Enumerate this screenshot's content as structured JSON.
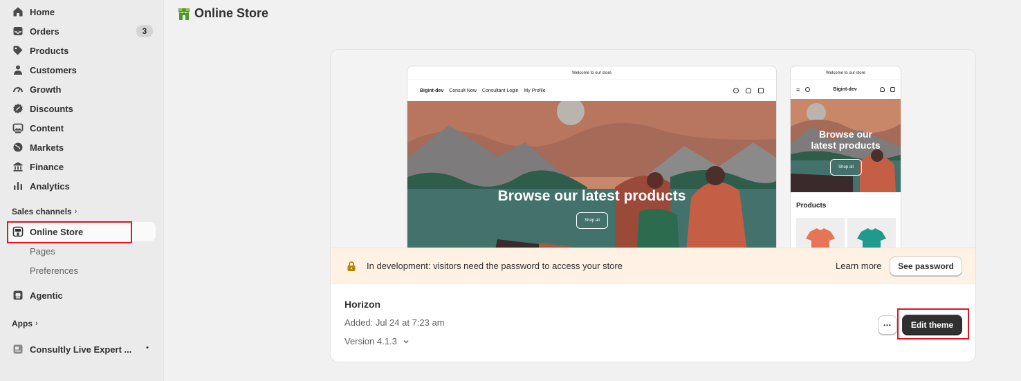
{
  "sidebar": {
    "items": [
      {
        "label": "Home",
        "icon": "home-icon"
      },
      {
        "label": "Orders",
        "icon": "inbox-icon",
        "badge": "3"
      },
      {
        "label": "Products",
        "icon": "tag-icon"
      },
      {
        "label": "Customers",
        "icon": "person-icon"
      },
      {
        "label": "Growth",
        "icon": "gauge-icon"
      },
      {
        "label": "Discounts",
        "icon": "discount-icon"
      },
      {
        "label": "Content",
        "icon": "image-icon"
      },
      {
        "label": "Markets",
        "icon": "globe-icon"
      },
      {
        "label": "Finance",
        "icon": "bank-icon"
      },
      {
        "label": "Analytics",
        "icon": "bar-chart-icon"
      }
    ],
    "sales_channels_label": "Sales channels",
    "online_store_label": "Online Store",
    "sub_items": [
      "Pages",
      "Preferences"
    ],
    "agentic_label": "Agentic",
    "apps_label": "Apps",
    "app_item_label": "Consultly Live Expert ...",
    "app_item_dot": "•"
  },
  "header": {
    "title": "Online Store"
  },
  "preview": {
    "announcement": "Welcome to our store",
    "brand": "Bigint-dev",
    "nav_links": [
      "Consult Now",
      "Consultant Login",
      "My Profile"
    ],
    "hero_title": "Browse our latest products",
    "hero_title_mobile_line1": "Browse our",
    "hero_title_mobile_line2": "latest products",
    "shop_all": "Shop all",
    "products_heading": "Products",
    "menu_glyph": "≡"
  },
  "banner": {
    "message": "In development: visitors need the password to access your store",
    "learn_more": "Learn more",
    "see_password": "See password"
  },
  "theme": {
    "name": "Horizon",
    "added": "Added: Jul 24 at 7:23 am",
    "version": "Version 4.1.3",
    "more_glyph": "•••",
    "edit_button": "Edit theme"
  },
  "colors": {
    "accent_highlight": "#e0151f",
    "banner_bg": "#fff1e3",
    "primary_button": "#303030",
    "brand_green": "#4c9a2a"
  }
}
